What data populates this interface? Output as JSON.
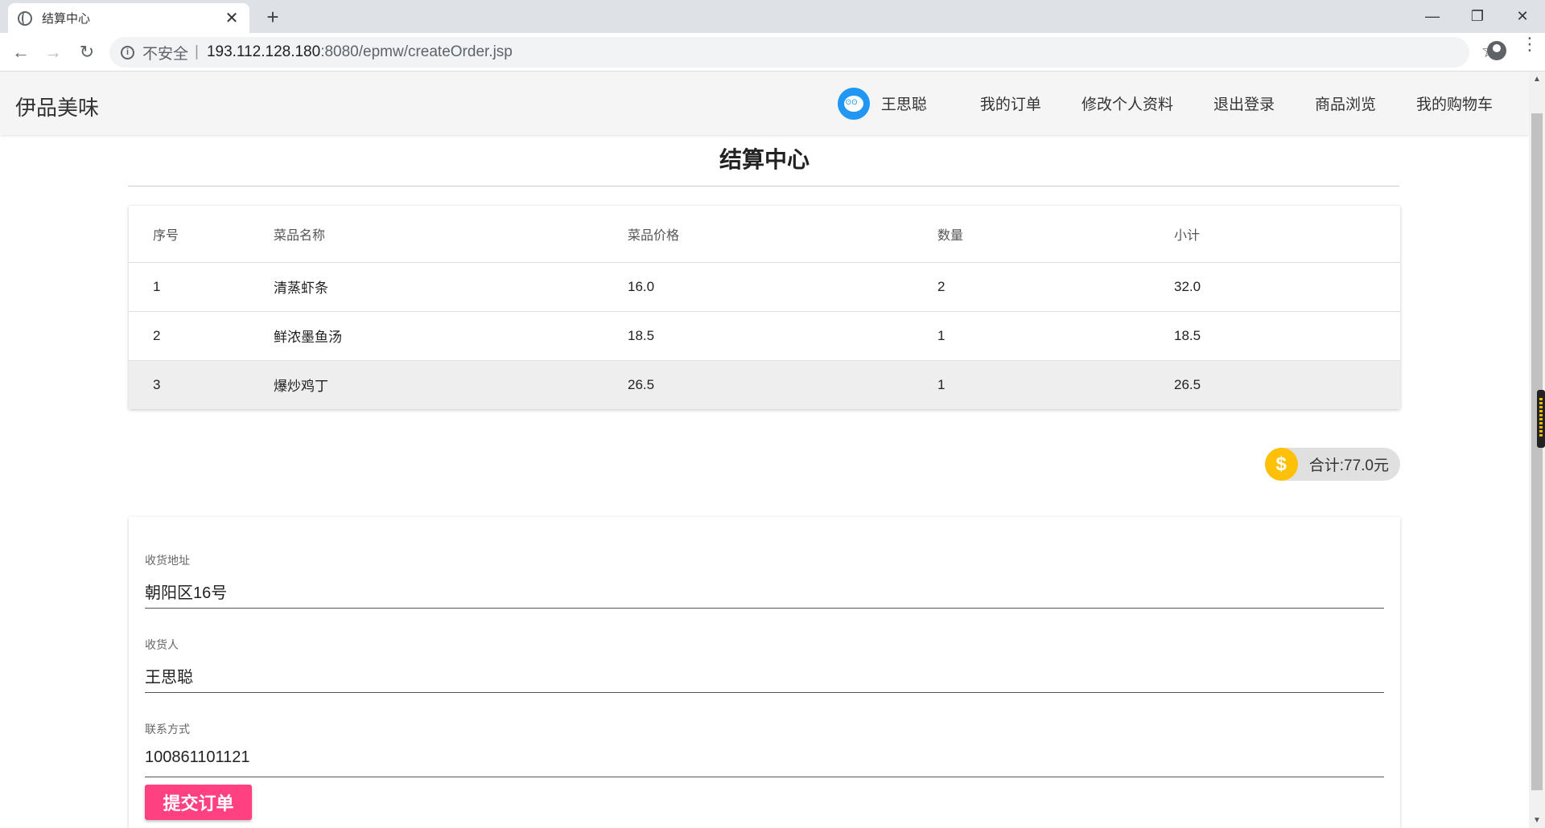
{
  "browser": {
    "tab_title": "结算中心",
    "close_tab": "✕",
    "new_tab": "+",
    "security_label": "不安全",
    "separator": "|",
    "url_host": "193.112.128.180",
    "url_path": ":8080/epmw/createOrder.jsp",
    "back": "←",
    "forward": "→",
    "reload": "↻",
    "bookmark": "☆",
    "minimize": "—",
    "maximize": "❐",
    "close": "✕",
    "menu": "⋮"
  },
  "header": {
    "brand": "伊品美味",
    "user_name": "王思聪",
    "nav": [
      "我的订单",
      "修改个人资料",
      "退出登录",
      "商品浏览",
      "我的购物车"
    ]
  },
  "page": {
    "title": "结算中心"
  },
  "order_table": {
    "columns": [
      "序号",
      "菜品名称",
      "菜品价格",
      "数量",
      "小计"
    ],
    "rows": [
      [
        "1",
        "清蒸虾条",
        "16.0",
        "2",
        "32.0"
      ],
      [
        "2",
        "鲜浓墨鱼汤",
        "18.5",
        "1",
        "18.5"
      ],
      [
        "3",
        "爆炒鸡丁",
        "26.5",
        "1",
        "26.5"
      ]
    ]
  },
  "total": {
    "icon": "$",
    "text": "合计:77.0元"
  },
  "form": {
    "address_label": "收货地址",
    "address_value": "朝阳区16号",
    "receiver_label": "收货人",
    "receiver_value": "王思聪",
    "contact_label": "联系方式",
    "contact_value": "100861101121",
    "submit_label": "提交订单"
  },
  "colors": {
    "accent": "#ff4081",
    "avatar": "#2196f3",
    "coin": "#ffc107"
  }
}
